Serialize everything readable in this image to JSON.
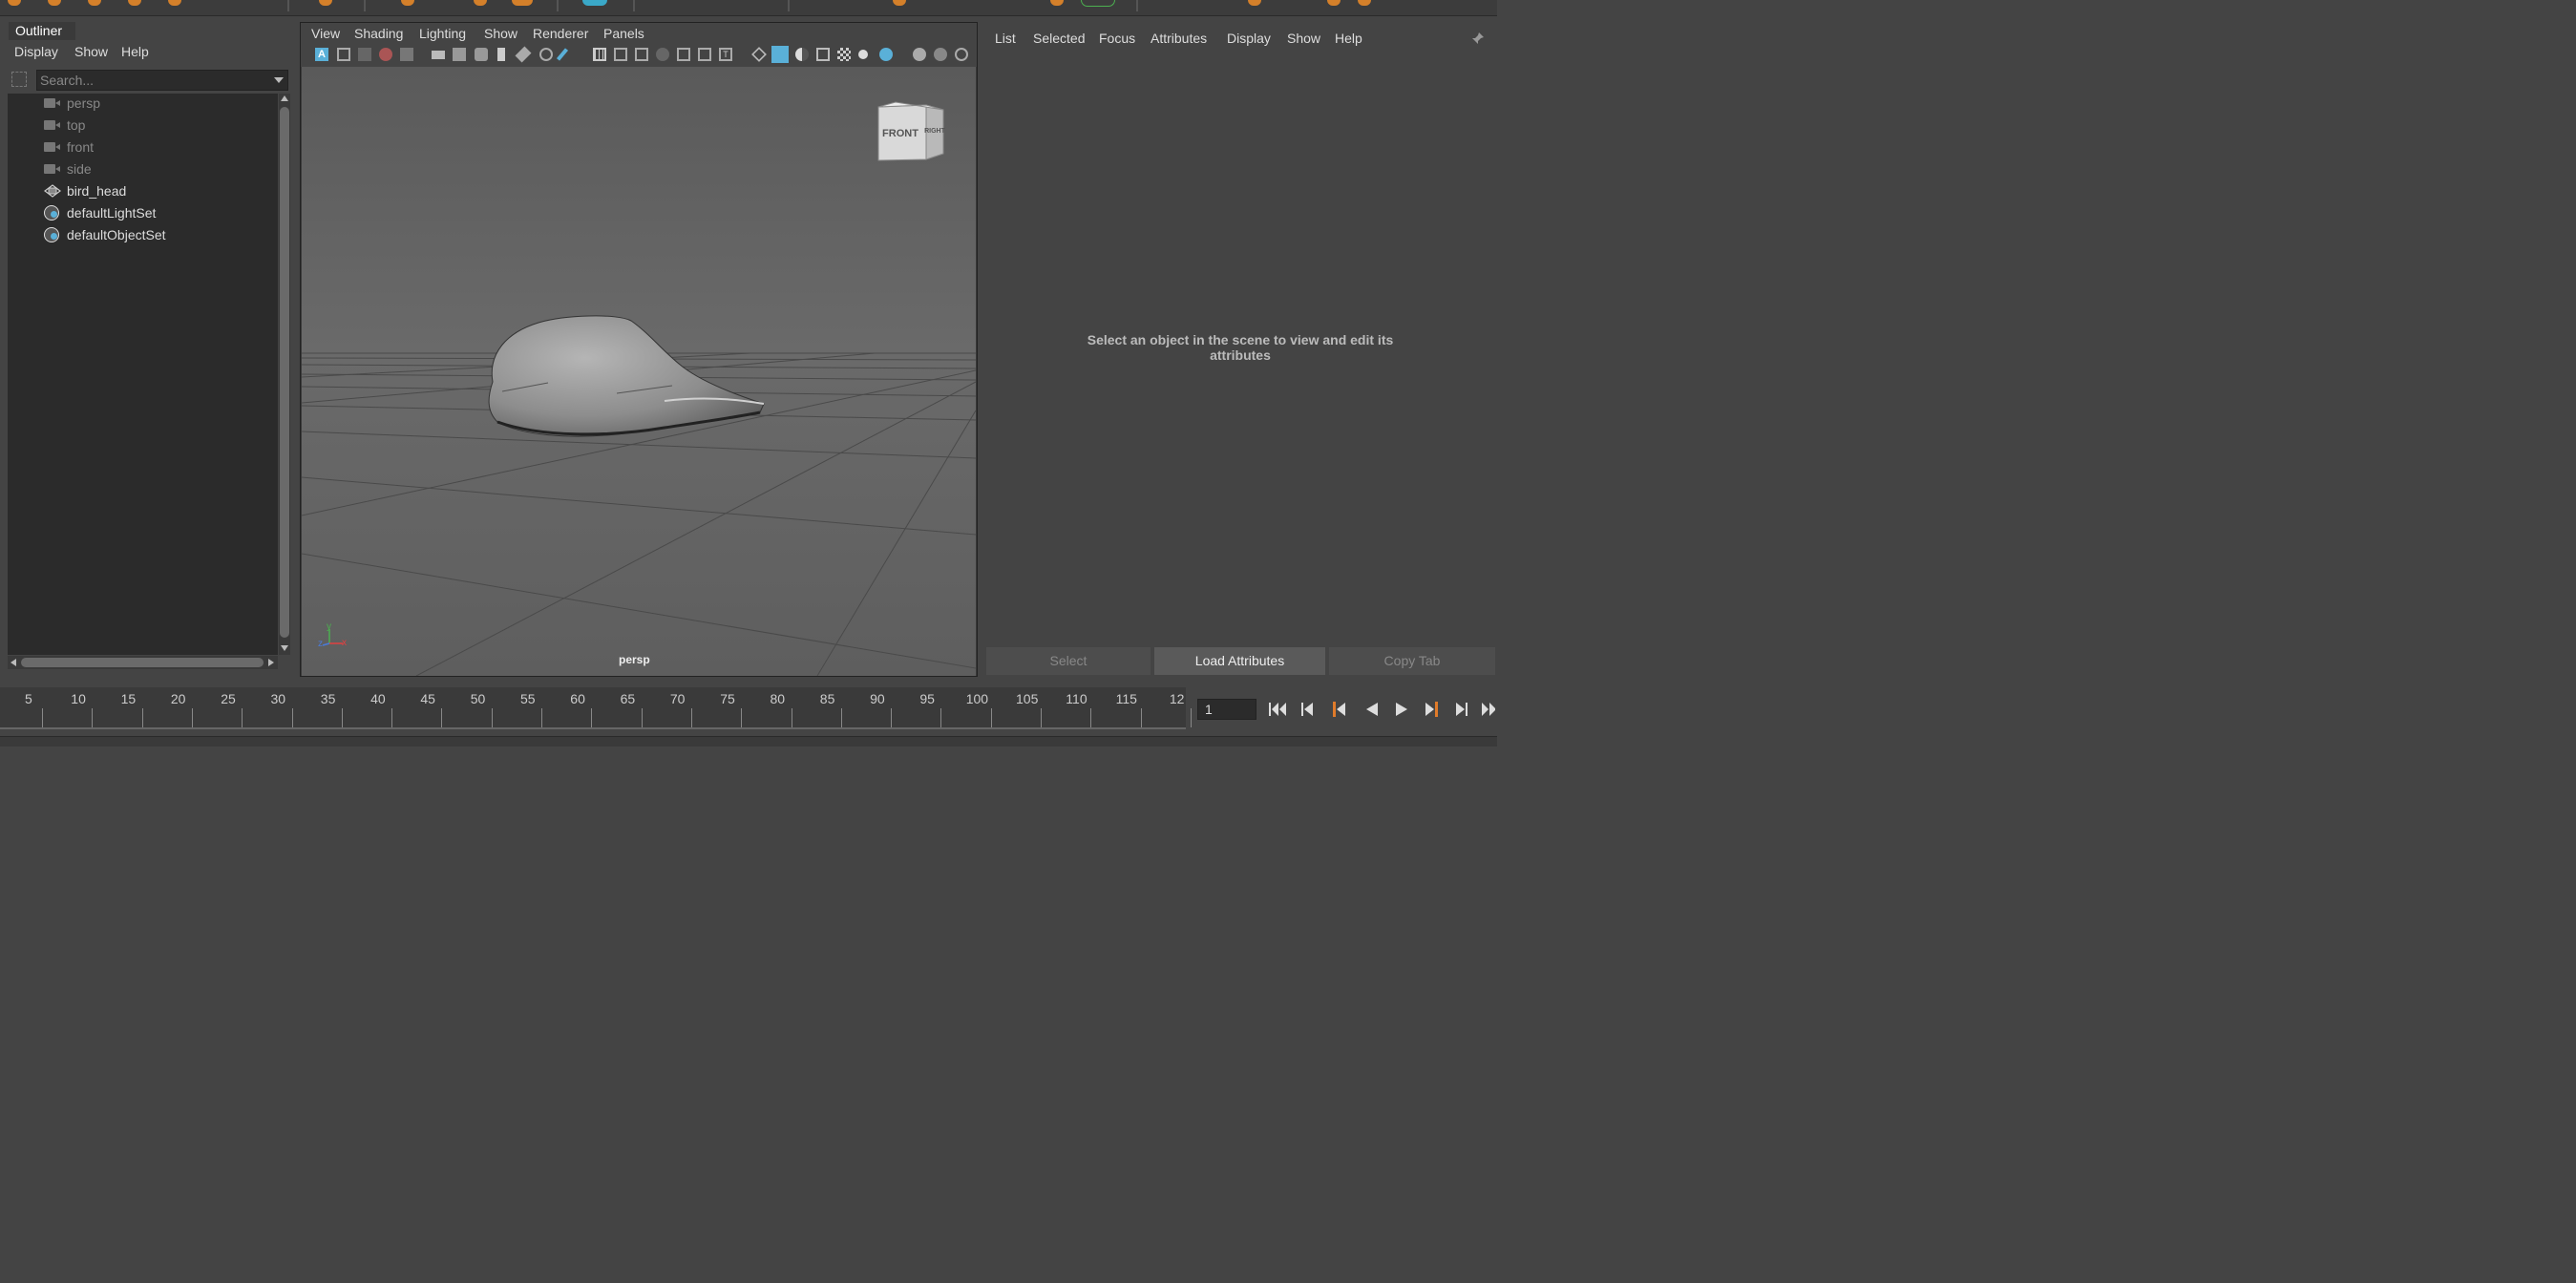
{
  "outliner": {
    "tab_title": "Outliner",
    "menu": [
      "Display",
      "Show",
      "Help"
    ],
    "search_placeholder": "Search...",
    "items": [
      {
        "label": "persp",
        "icon": "camera-icon"
      },
      {
        "label": "top",
        "icon": "camera-icon"
      },
      {
        "label": "front",
        "icon": "camera-icon"
      },
      {
        "label": "side",
        "icon": "camera-icon"
      },
      {
        "label": "bird_head",
        "icon": "mesh-icon"
      },
      {
        "label": "defaultLightSet",
        "icon": "set-icon"
      },
      {
        "label": "defaultObjectSet",
        "icon": "set-icon"
      }
    ]
  },
  "viewport": {
    "menu": [
      "View",
      "Shading",
      "Lighting",
      "Show",
      "Renderer",
      "Panels"
    ],
    "camera_label": "persp",
    "viewcube_front": "FRONT",
    "viewcube_right": "RIGHT",
    "axis_labels": {
      "x": "x",
      "y": "y",
      "z": "z"
    }
  },
  "attribute_editor": {
    "menu": [
      "List",
      "Selected",
      "Focus",
      "Attributes",
      "Display",
      "Show",
      "Help"
    ],
    "message": "Select an object in the scene to view and edit its attributes",
    "buttons": {
      "select": "Select",
      "load": "Load Attributes",
      "copy": "Copy Tab"
    }
  },
  "timeline": {
    "ticks": [
      "5",
      "10",
      "15",
      "20",
      "25",
      "30",
      "35",
      "40",
      "45",
      "50",
      "55",
      "60",
      "65",
      "70",
      "75",
      "80",
      "85",
      "90",
      "95",
      "100",
      "105",
      "110",
      "115",
      "12"
    ],
    "current_frame": "1"
  },
  "colors": {
    "accent_blue": "#5ab0d8",
    "shelf_orange": "#d4802a",
    "playback_orange": "#e07b2a"
  }
}
